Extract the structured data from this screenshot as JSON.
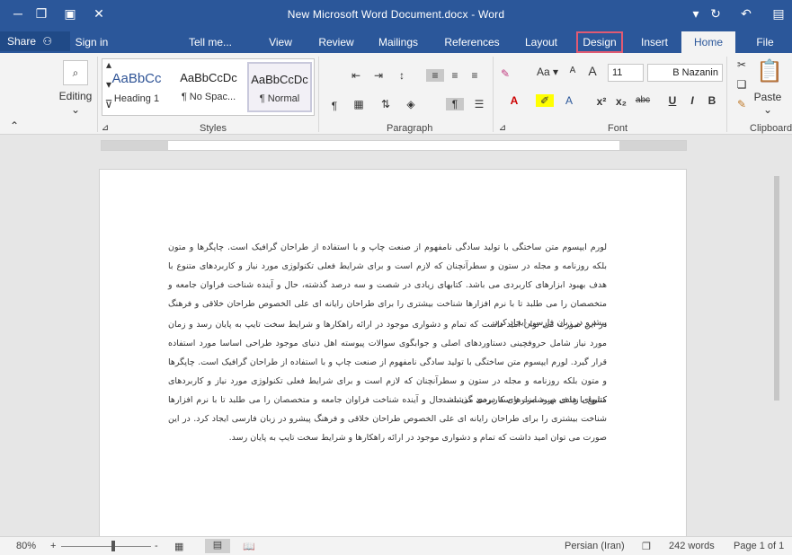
{
  "window": {
    "title": "New Microsoft Word Document.docx - Word"
  },
  "tabs": {
    "file": "File",
    "home": "Home",
    "insert": "Insert",
    "design": "Design",
    "layout": "Layout",
    "references": "References",
    "mailings": "Mailings",
    "review": "Review",
    "view": "View",
    "tell_me": "Tell me...",
    "sign_in": "Sign in",
    "share": "Share"
  },
  "ribbon": {
    "clipboard_label": "Clipboard",
    "paste_label": "Paste",
    "font_label": "Font",
    "font_name": "B Nazanin",
    "font_size": "11",
    "paragraph_label": "Paragraph",
    "styles_label": "Styles",
    "editing_label": "Editing",
    "styles": [
      {
        "preview": "AaBbCcDc",
        "name": "¶ Normal"
      },
      {
        "preview": "AaBbCcDc",
        "name": "¶ No Spac..."
      },
      {
        "preview": "AaBbCc",
        "name": "Heading 1"
      }
    ],
    "font_buttons": {
      "bold": "B",
      "italic": "I",
      "underline": "U",
      "strike": "abc",
      "subscript": "x₂",
      "superscript": "x²",
      "grow": "A",
      "shrink": "A",
      "case": "Aa"
    }
  },
  "document": {
    "paragraphs": [
      "لورم ایپسوم متن ساختگی با تولید سادگی نامفهوم از صنعت چاپ و با استفاده از طراحان گرافیک است. چاپگرها و متون بلکه روزنامه و مجله در ستون و سطرآنچنان که لازم است و برای شرایط فعلی تکنولوژی مورد نیاز و کاربردهای متنوع با هدف بهبود ابزارهای کاربردی می باشد. کتابهای زیادی در شصت و سه درصد گذشته، حال و آینده شناخت فراوان جامعه و متخصصان را می طلبد تا با نرم افزارها شناخت بیشتری را برای طراحان رایانه ای علی الخصوص طراحان خلاقی و فرهنگ پیشرو در زبان فارسی ایجاد کرد.",
      "در این صورت می توان امید داشت که تمام و دشواری موجود در ارائه راهکارها و شرایط سخت تایپ به پایان رسد و زمان مورد نیاز شامل حروفچینی دستاوردهای اصلی و جوابگوی سوالات پیوسته اهل دنیای موجود طراحی اساسا مورد استفاده قرار گیرد. لورم ایپسوم متن ساختگی با تولید سادگی نامفهوم از صنعت چاپ و با استفاده از طراحان گرافیک است. چاپگرها و متون بلکه روزنامه و مجله در ستون و سطرآنچنان که لازم است و برای شرایط فعلی تکنولوژی مورد نیاز و کاربردهای متنوع با هدف بهبود ابزارهای کاربردی می باشد.",
      "کتابهای زیادی در شصت و سه درصد گذشته، حال و آینده شناخت فراوان جامعه و متخصصان را می طلبد تا با نرم افزارها شناخت بیشتری را برای طراحان رایانه ای علی الخصوص طراحان خلاقی و فرهنگ پیشرو در زبان فارسی ایجاد کرد. در این صورت می توان امید داشت که تمام و دشواری موجود در ارائه راهکارها و شرایط سخت تایپ به پایان رسد."
    ]
  },
  "status": {
    "page": "Page 1 of 1",
    "words": "242 words",
    "language": "Persian (Iran)",
    "zoom": "80%",
    "zoom_minus": "-",
    "zoom_plus": "+"
  }
}
